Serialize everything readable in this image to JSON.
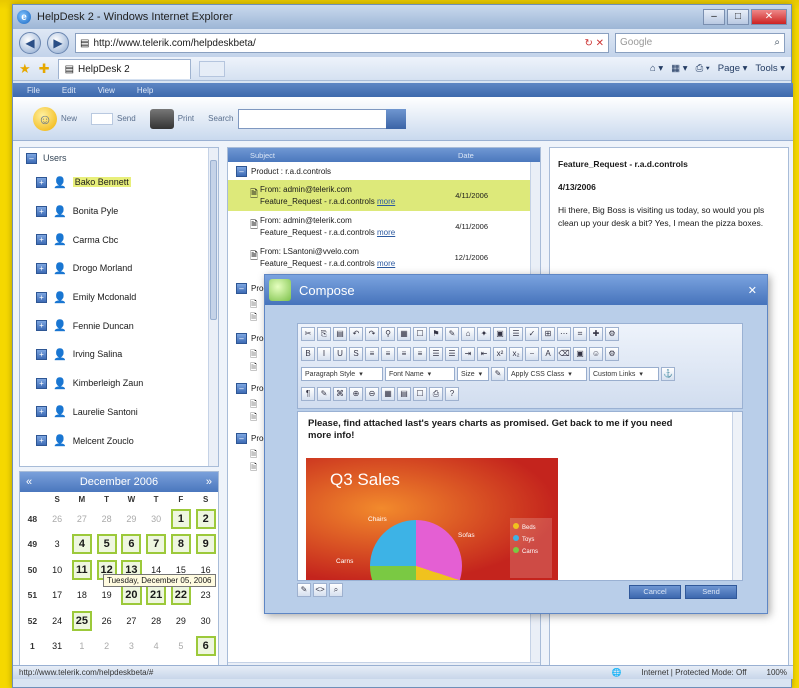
{
  "browser": {
    "title": "HelpDesk 2 - Windows Internet Explorer",
    "url": "http://www.telerik.com/helpdeskbeta/",
    "search_placeholder": "Google",
    "tab_label": "HelpDesk 2",
    "tools": [
      "Page ▾",
      "Tools ▾"
    ],
    "status_url": "http://www.telerik.com/helpdeskbeta/#",
    "status_zone": "Internet | Protected Mode: Off",
    "status_zoom": "100%"
  },
  "app": {
    "menu": [
      "File",
      "Edit",
      "View",
      "Help"
    ],
    "toolbar": {
      "new_label": "New",
      "send_label": "Send",
      "print_label": "Print",
      "search_label": "Search"
    },
    "users_header": "Users",
    "users": [
      "Bako Bennett",
      "Bonita Pyle",
      "Carma Cbc",
      "Drogo Morland",
      "Emily Mcdonald",
      "Fennie Duncan",
      "Irving Salina",
      "Kimberleigh Zaun",
      "Laurelie Santoni",
      "Melcent Zouclo"
    ],
    "selected_user": 0,
    "calendar": {
      "title": "December 2006",
      "weekdays": [
        "S",
        "M",
        "T",
        "W",
        "T",
        "F",
        "S"
      ],
      "weeks": [
        {
          "wk": "48",
          "days": [
            "26",
            "27",
            "28",
            "29",
            "30",
            "1",
            "2"
          ]
        },
        {
          "wk": "49",
          "days": [
            "3",
            "4",
            "5",
            "6",
            "7",
            "8",
            "9"
          ]
        },
        {
          "wk": "50",
          "days": [
            "10",
            "11",
            "12",
            "13",
            "14",
            "15",
            "16"
          ]
        },
        {
          "wk": "51",
          "days": [
            "17",
            "18",
            "19",
            "20",
            "21",
            "22",
            "23"
          ]
        },
        {
          "wk": "52",
          "days": [
            "24",
            "25",
            "26",
            "27",
            "28",
            "29",
            "30"
          ]
        },
        {
          "wk": "1",
          "days": [
            "31",
            "1",
            "2",
            "3",
            "4",
            "5",
            "6"
          ]
        }
      ],
      "tooltip": "Tuesday, December 05, 2006"
    },
    "messages_header": {
      "subject": "Subject",
      "date": "Date"
    },
    "group_label": "Product : r.a.d.controls",
    "group_short": "Prod",
    "messages": [
      {
        "from": "From: admin@telerik.com",
        "subject": "Feature_Request - r.a.d.controls",
        "more": "more",
        "date": "4/11/2006"
      },
      {
        "from": "From: admin@telerik.com",
        "subject": "Feature_Request - r.a.d.controls",
        "more": "more",
        "date": "4/11/2006"
      },
      {
        "from": "From: LSantoni@vvelo.com",
        "subject": "Feature_Request - r.a.d.controls",
        "more": "more",
        "date": "12/1/2006"
      }
    ],
    "preview": {
      "subject": "Feature_Request - r.a.d.controls",
      "date": "4/13/2006",
      "body": "Hi there, Big Boss is visiting us today, so would you pls clean up your desk a bit? Yes, I mean the pizza boxes."
    }
  },
  "compose": {
    "title": "Compose",
    "dropdowns": [
      "Paragraph Style",
      "Font Name",
      "Size",
      "Apply CSS Class",
      "Custom Links"
    ],
    "body": "Please, find attached last's years charts as promised. Get back to me if you need more info!",
    "slide": {
      "title": "Q3 Sales",
      "labels": [
        "Chairs",
        "Sofas",
        "Carns"
      ],
      "legend": [
        "Beds",
        "Toys",
        "Carns"
      ]
    },
    "cancel_label": "Cancel",
    "send_label": "Send"
  },
  "colors": {
    "accent": "#4a77bd",
    "event_border": "#9cc93a",
    "selection": "#dde97a",
    "desktop": "#f5d800"
  }
}
